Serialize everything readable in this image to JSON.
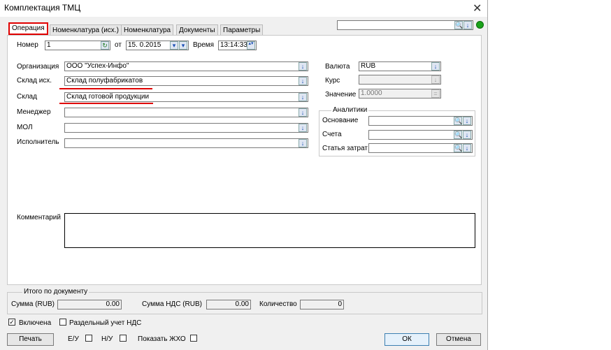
{
  "window": {
    "title": "Комплектация ТМЦ",
    "close_label": "✕"
  },
  "tabs": [
    "Операция",
    "Номенклатура (исх.)",
    "Номенклатура",
    "Документы",
    "Параметры"
  ],
  "header": {
    "number_label": "Номер",
    "number_value": "1",
    "from_label": "от",
    "date_value": "15. 0.2015",
    "time_label": "Время",
    "time_value": "13:14:33"
  },
  "fields": {
    "organization_label": "Организация",
    "organization_value": "ООО \"Успех-Инфо\"",
    "warehouse_src_label": "Склад исх.",
    "warehouse_src_value": "Склад полуфабрикатов",
    "warehouse_label": "Склад",
    "warehouse_value": "Склад готовой продукции",
    "manager_label": "Менеджер",
    "manager_value": "",
    "mol_label": "МОЛ",
    "mol_value": "",
    "executor_label": "Исполнитель",
    "executor_value": ""
  },
  "currency": {
    "currency_label": "Валюта",
    "currency_value": "RUB",
    "rate_label": "Курс",
    "rate_value": "",
    "value_label": "Значение",
    "value_value": "1.0000"
  },
  "analytics": {
    "title": "Аналитики",
    "basis_label": "Основание",
    "accounts_label": "Счета",
    "cost_label": "Статья затрат"
  },
  "comment_label": "Комментарий",
  "totals": {
    "title": "Итого по документу",
    "sum_label": "Сумма (RUB)",
    "sum_value": "0.00",
    "vat_label": "Сумма НДС (RUB)",
    "vat_value": "0.00",
    "qty_label": "Количество",
    "qty_value": "0"
  },
  "options": {
    "enabled_label": "Включена",
    "enabled_checked": true,
    "separate_vat_label": "Раздельный учет НДС"
  },
  "footer": {
    "print_label": "Печать",
    "eu_label": "Е/У",
    "nu_label": "Н/У",
    "show_label": "Показать ЖХО",
    "ok_label": "ОК",
    "cancel_label": "Отмена"
  },
  "icons": {
    "dropdown": "↓",
    "search": "🔍",
    "refresh": "↻",
    "calc": "="
  },
  "colors": {
    "status": "#1aa31a",
    "highlight": "#e00000"
  }
}
